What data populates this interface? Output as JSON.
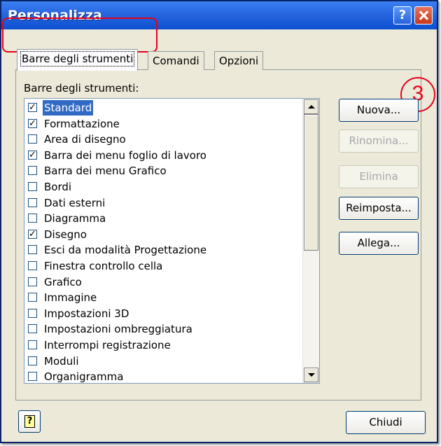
{
  "window": {
    "title": "Personalizza",
    "help_glyph": "?",
    "close_icon": "close-icon"
  },
  "tabs": [
    {
      "label": "Barre degli strumenti",
      "active": true
    },
    {
      "label": "Comandi",
      "active": false
    },
    {
      "label": "Opzioni",
      "active": false
    }
  ],
  "annotation": {
    "step": "3",
    "color": "#e8001a"
  },
  "toolbars_panel": {
    "list_label": "Barre degli strumenti:",
    "items": [
      {
        "label": "Standard",
        "checked": true,
        "selected": true
      },
      {
        "label": "Formattazione",
        "checked": true,
        "selected": false
      },
      {
        "label": "Area di disegno",
        "checked": false,
        "selected": false
      },
      {
        "label": "Barra dei menu foglio di lavoro",
        "checked": true,
        "selected": false
      },
      {
        "label": "Barra dei menu Grafico",
        "checked": false,
        "selected": false
      },
      {
        "label": "Bordi",
        "checked": false,
        "selected": false
      },
      {
        "label": "Dati esterni",
        "checked": false,
        "selected": false
      },
      {
        "label": "Diagramma",
        "checked": false,
        "selected": false
      },
      {
        "label": "Disegno",
        "checked": true,
        "selected": false
      },
      {
        "label": "Esci da modalità Progettazione",
        "checked": false,
        "selected": false
      },
      {
        "label": "Finestra controllo cella",
        "checked": false,
        "selected": false
      },
      {
        "label": "Grafico",
        "checked": false,
        "selected": false
      },
      {
        "label": "Immagine",
        "checked": false,
        "selected": false
      },
      {
        "label": "Impostazioni 3D",
        "checked": false,
        "selected": false
      },
      {
        "label": "Impostazioni ombreggiatura",
        "checked": false,
        "selected": false
      },
      {
        "label": "Interrompi registrazione",
        "checked": false,
        "selected": false
      },
      {
        "label": "Moduli",
        "checked": false,
        "selected": false
      },
      {
        "label": "Organigramma",
        "checked": false,
        "selected": false
      }
    ],
    "buttons": {
      "new": "Nuova...",
      "rename": "Rinomina...",
      "delete": "Elimina",
      "reset": "Reimposta...",
      "attach": "Allega..."
    }
  },
  "footer": {
    "help_glyph": "?",
    "close_label": "Chiudi"
  },
  "colors": {
    "titlebar": "#0c4fd0",
    "selection": "#316ac5",
    "dialog_bg": "#ece9d8"
  }
}
